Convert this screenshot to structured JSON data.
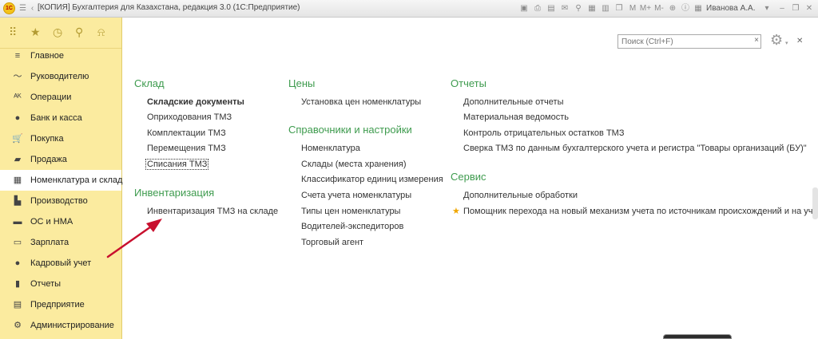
{
  "window": {
    "title": "[КОПИЯ] Бухгалтерия для Казахстана, редакция 3.0  (1С:Предприятие)",
    "user": "Иванова А.А.",
    "logo_text": "1С",
    "toolbar": [
      "M",
      "M+",
      "M-"
    ]
  },
  "sidebar": {
    "top_icons": [
      "apps-grid-icon",
      "star-icon",
      "history-icon",
      "search-icon",
      "bell-icon"
    ],
    "items": [
      {
        "label": "Главное",
        "icon": "menu-lines-icon"
      },
      {
        "label": "Руководителю",
        "icon": "trend-chart-icon"
      },
      {
        "label": "Операции",
        "icon": "operations-icon"
      },
      {
        "label": "Банк и касса",
        "icon": "bank-coin-icon"
      },
      {
        "label": "Покупка",
        "icon": "cart-icon"
      },
      {
        "label": "Продажа",
        "icon": "bag-icon"
      },
      {
        "label": "Номенклатура и склад",
        "icon": "warehouse-icon",
        "active": true
      },
      {
        "label": "Производство",
        "icon": "factory-icon"
      },
      {
        "label": "ОС и НМА",
        "icon": "truck-icon"
      },
      {
        "label": "Зарплата",
        "icon": "wallet-icon"
      },
      {
        "label": "Кадровый учет",
        "icon": "person-icon"
      },
      {
        "label": "Отчеты",
        "icon": "bar-chart-icon"
      },
      {
        "label": "Предприятие",
        "icon": "building-icon"
      },
      {
        "label": "Администрирование",
        "icon": "gear-icon"
      }
    ]
  },
  "search": {
    "placeholder": "Поиск (Ctrl+F)"
  },
  "columns": {
    "col1": {
      "groups": [
        {
          "title": "Склад",
          "links": [
            "Складские документы",
            "Оприходования ТМЗ",
            "Комплектации ТМЗ",
            "Перемещения ТМЗ",
            "Списания ТМЗ"
          ]
        },
        {
          "title": "Инвентаризация",
          "links": [
            "Инвентаризация ТМЗ на складе"
          ]
        }
      ]
    },
    "col2": {
      "groups": [
        {
          "title": "Цены",
          "links": [
            "Установка цен номенклатуры"
          ]
        },
        {
          "title": "Справочники и настройки",
          "links": [
            "Номенклатура",
            "Склады (места хранения)",
            "Классификатор единиц измерения",
            "Счета учета номенклатуры",
            "Типы цен номенклатуры",
            "Водителей-экспедиторов",
            "Торговый агент"
          ]
        }
      ]
    },
    "col3": {
      "groups": [
        {
          "title": "Отчеты",
          "links": [
            "Дополнительные отчеты",
            "Материальная ведомость",
            "Контроль отрицательных остатков ТМЗ",
            "Сверка ТМЗ по данным бухгалтерского учета и регистра \"Товары организаций (БУ)\""
          ]
        },
        {
          "title": "Сервис",
          "links": [
            "Дополнительные обработки",
            "Помощник перехода на новый механизм учета по источникам происхождений и на учет товаров"
          ]
        }
      ]
    }
  },
  "colors": {
    "group_title": "#3e9b4e",
    "sidebar_bg": "#fbeb9f",
    "arrow": "#c8102e",
    "favorite_star": "#f0a600"
  }
}
